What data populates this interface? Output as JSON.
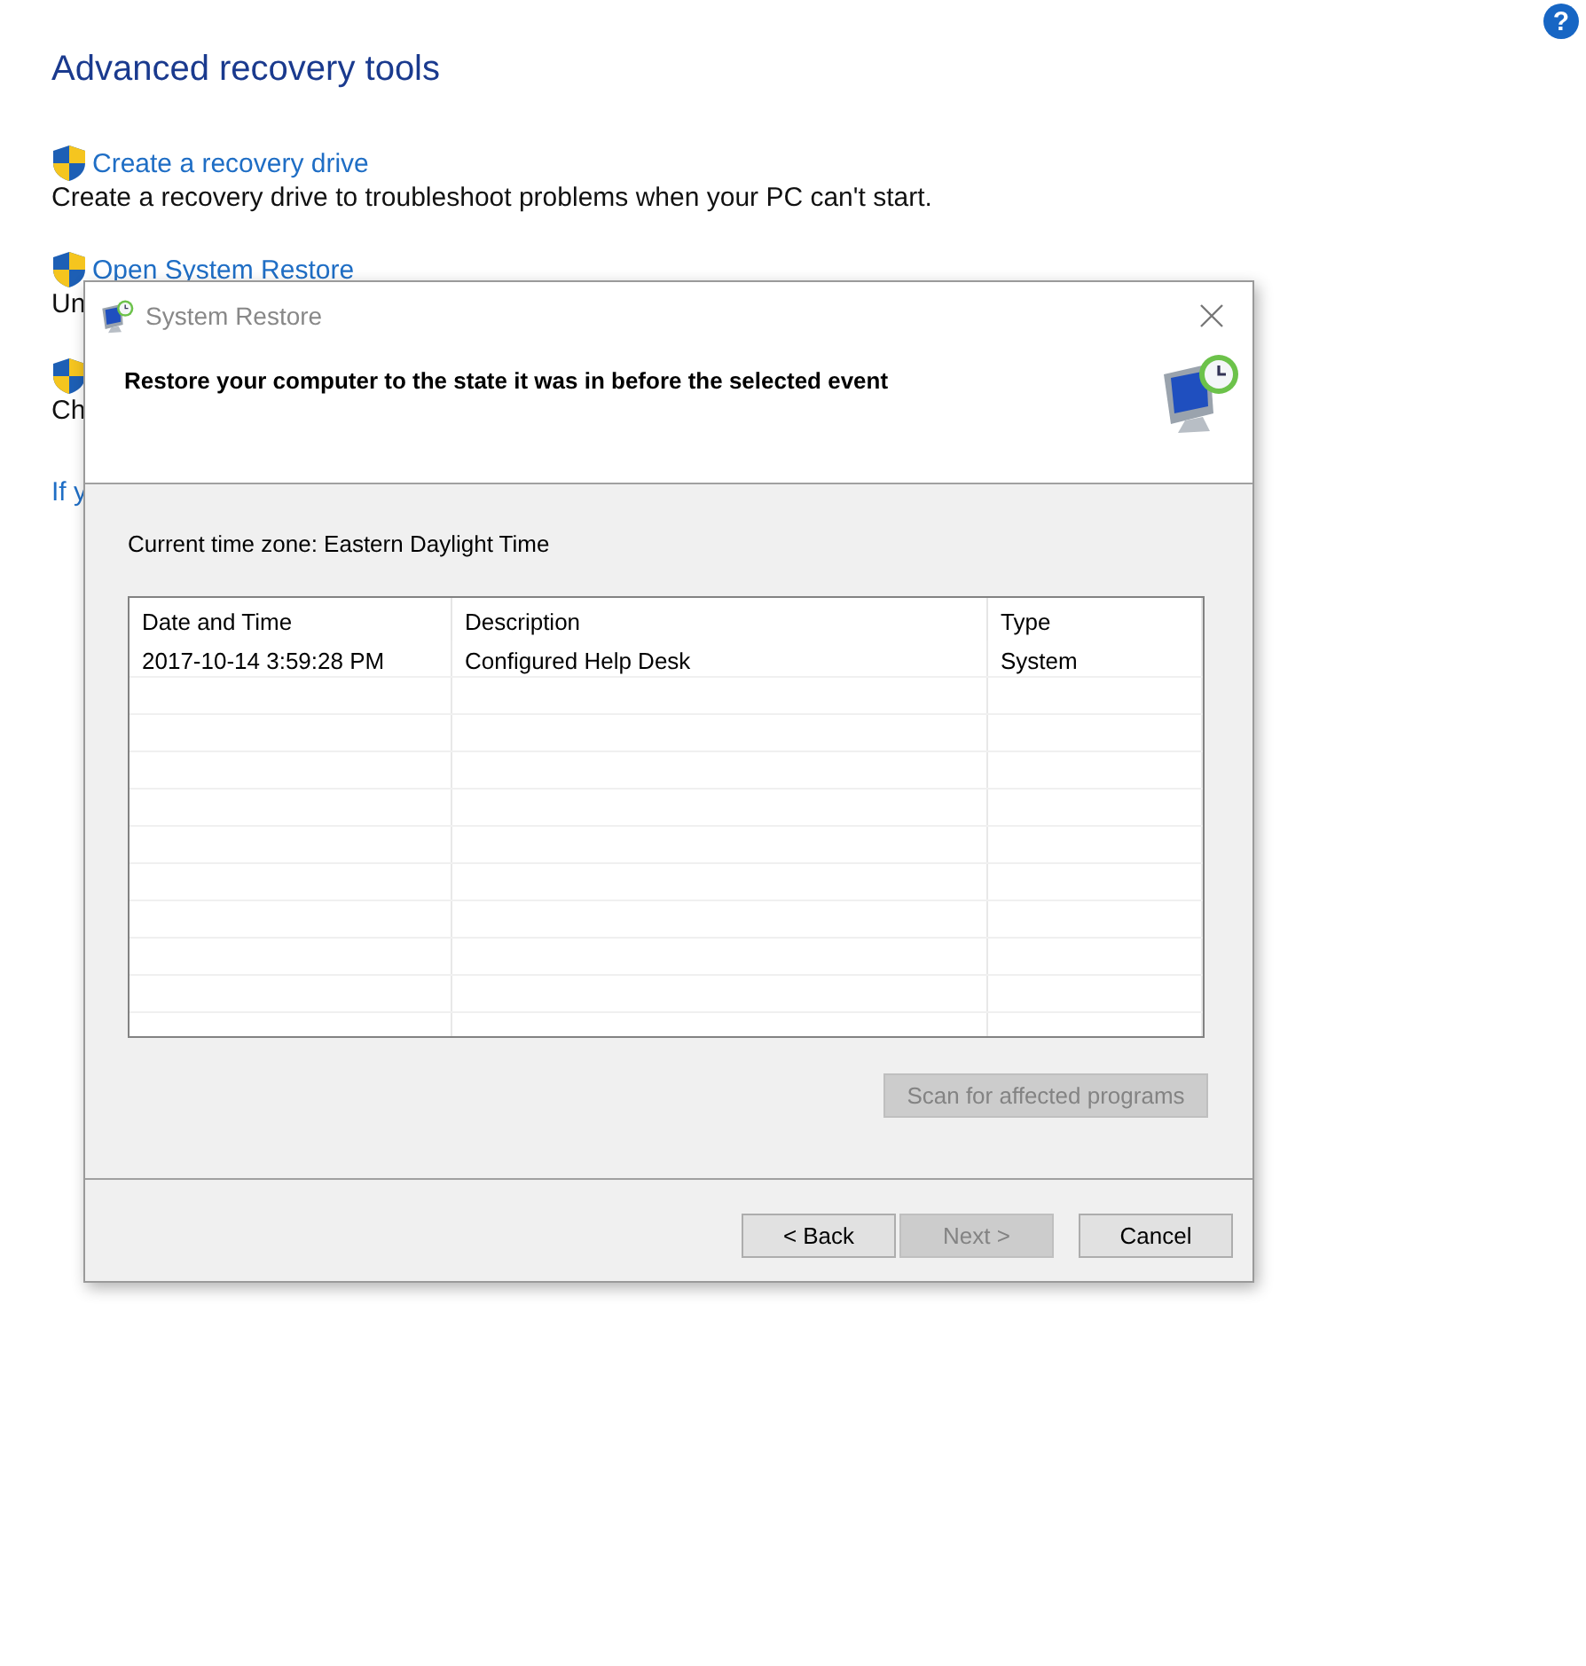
{
  "help_glyph": "?",
  "page": {
    "title": "Advanced recovery tools",
    "items": [
      {
        "link": "Create a recovery drive",
        "description": "Create a recovery drive to troubleshoot problems when your PC can't start."
      },
      {
        "link": "Open System Restore",
        "description": "Un"
      },
      {
        "description": "Ch"
      }
    ],
    "footer_link": "If y"
  },
  "dialog": {
    "title": "System Restore",
    "heading": "Restore your computer to the state it was in before the selected event",
    "timezone": "Current time zone: Eastern Daylight Time",
    "table": {
      "columns": [
        "Date and Time",
        "Description",
        "Type"
      ],
      "rows": [
        [
          "2017-10-14 3:59:28 PM",
          "Configured Help Desk",
          "System"
        ]
      ]
    },
    "scan_button": {
      "label": "Scan for affected programs",
      "disabled": true
    },
    "buttons": [
      {
        "label": "< Back",
        "disabled": false
      },
      {
        "label": "Next >",
        "disabled": true
      },
      {
        "label": "Cancel",
        "disabled": false
      }
    ]
  }
}
